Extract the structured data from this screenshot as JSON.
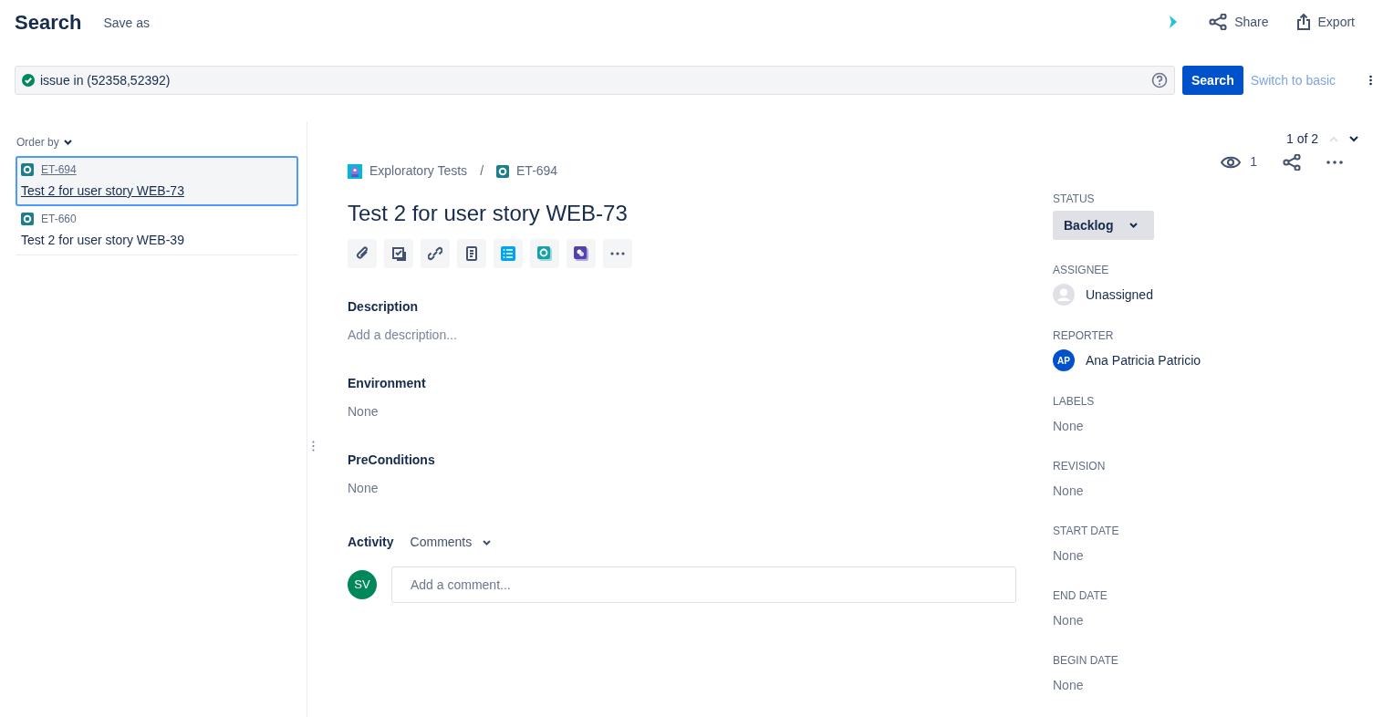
{
  "header": {
    "title": "Search",
    "save_as": "Save as",
    "share": "Share",
    "export": "Export"
  },
  "query": {
    "valid": true,
    "text": "issue in (52358,52392)",
    "search_button": "Search",
    "switch_link": "Switch to basic"
  },
  "results": {
    "order_by": "Order by",
    "items": [
      {
        "key": "ET-694",
        "summary": "Test 2 for user story WEB-73",
        "selected": true
      },
      {
        "key": "ET-660",
        "summary": "Test 2 for user story WEB-39",
        "selected": false
      }
    ]
  },
  "pager": "1 of 2",
  "issue": {
    "project": "Exploratory Tests",
    "separator": "/",
    "key": "ET-694",
    "watchers": "1",
    "title": "Test 2 for user story WEB-73",
    "sections": [
      {
        "label": "Description",
        "value": "Add a description...",
        "kind": "placeholder"
      },
      {
        "label": "Environment",
        "value": "None",
        "kind": "value"
      },
      {
        "label": "PreConditions",
        "value": "None",
        "kind": "value"
      }
    ],
    "activity": {
      "label": "Activity",
      "filter": "Comments",
      "avatar": "SV",
      "comment_placeholder": "Add a comment..."
    }
  },
  "side": {
    "status": {
      "label": "STATUS",
      "value": "Backlog"
    },
    "people": [
      {
        "label": "ASSIGNEE",
        "value": "Unassigned",
        "kind": "unassigned"
      },
      {
        "label": "REPORTER",
        "value": "Ana Patricia Patricio",
        "kind": "user",
        "initials": "AP"
      }
    ],
    "fields": [
      {
        "label": "LABELS",
        "value": "None"
      },
      {
        "label": "REVISION",
        "value": "None"
      },
      {
        "label": "START DATE",
        "value": "None"
      },
      {
        "label": "END DATE",
        "value": "None"
      },
      {
        "label": "BEGIN DATE",
        "value": "None"
      }
    ]
  }
}
